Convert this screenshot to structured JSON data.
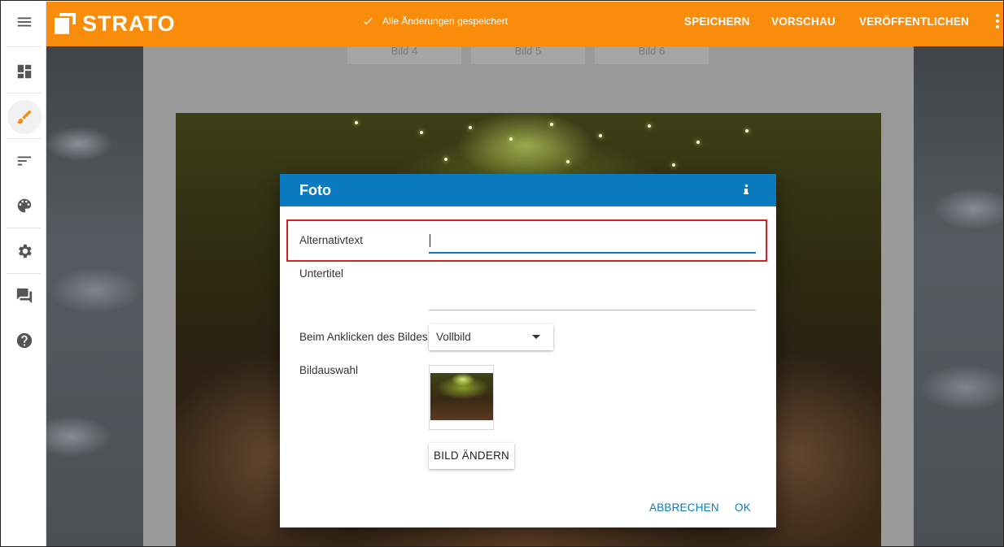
{
  "topbar": {
    "brand": "STRATO",
    "status": "Alle Änderungen gespeichert",
    "save_label": "SPEICHERN",
    "preview_label": "VORSCHAU",
    "publish_label": "VERÖFFENTLICHEN"
  },
  "sidebar": {
    "items": [
      {
        "icon": "menu-icon"
      },
      {
        "icon": "dashboard-icon"
      },
      {
        "icon": "brush-icon",
        "active": true
      },
      {
        "icon": "sort-icon"
      },
      {
        "icon": "palette-icon"
      },
      {
        "icon": "gear-icon"
      },
      {
        "icon": "forum-icon"
      },
      {
        "icon": "help-icon"
      }
    ]
  },
  "background": {
    "thumb_tabs": [
      "Bild 4",
      "Bild 5",
      "Bild 6"
    ]
  },
  "dialog": {
    "title": "Foto",
    "info_icon": "info-icon",
    "alt_text_label": "Alternativtext",
    "alt_text_value": "",
    "subtitle_label": "Untertitel",
    "subtitle_value": "",
    "click_label": "Beim Anklicken des Bildes",
    "click_value": "Vollbild",
    "image_select_label": "Bildauswahl",
    "change_image_label": "BILD ÄNDERN",
    "cancel_label": "ABBRECHEN",
    "ok_label": "OK"
  },
  "colors": {
    "topbar": "#f98c0b",
    "dialog_header": "#0b7bbf",
    "highlight": "#d0212b",
    "accent_active": "#f98c0b"
  }
}
